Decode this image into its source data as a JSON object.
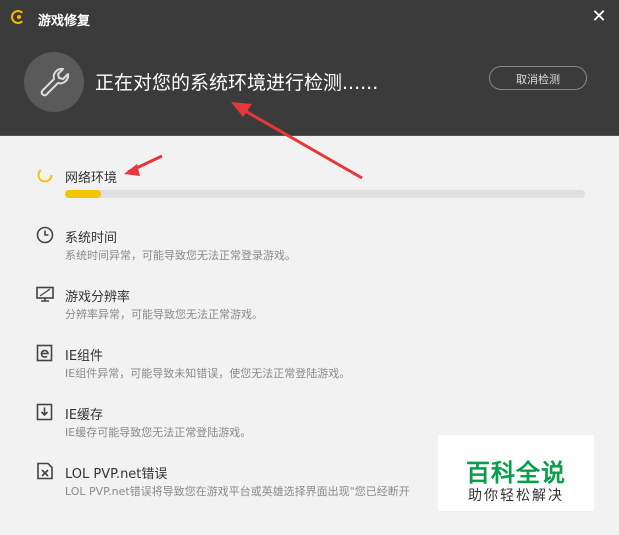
{
  "window": {
    "title": "游戏修复",
    "close_glyph": "✕"
  },
  "header": {
    "message": "正在对您的系统环境进行检测......",
    "cancel_label": "取消检测"
  },
  "checks": [
    {
      "name": "网络环境",
      "desc": "",
      "icon": "spinner-icon",
      "progress": 0.07
    },
    {
      "name": "系统时间",
      "desc": "系统时间异常，可能导致您无法正常登录游戏。",
      "icon": "clock-icon"
    },
    {
      "name": "游戏分辨率",
      "desc": "分辨率异常，可能导致您无法正常游戏。",
      "icon": "monitor-icon"
    },
    {
      "name": "IE组件",
      "desc": "IE组件异常，可能导致未知错误，使您无法正常登陆游戏。",
      "icon": "ie-icon"
    },
    {
      "name": "IE缓存",
      "desc": "IE缓存可能导致您无法正常登陆游戏。",
      "icon": "download-box-icon"
    },
    {
      "name": "LOL PVP.net错误",
      "desc": "LOL PVP.net错误将导致您在游戏平台或英雄选择界面出现\"您已经断开",
      "icon": "error-file-icon"
    }
  ],
  "watermark": {
    "main": "百科全说",
    "sub": "助你轻松解决"
  },
  "colors": {
    "titlebar": "#3b3b3b",
    "accent_yellow": "#f5c400",
    "arrow_red": "#e8373a",
    "watermark_green": "#0a9e4c"
  }
}
